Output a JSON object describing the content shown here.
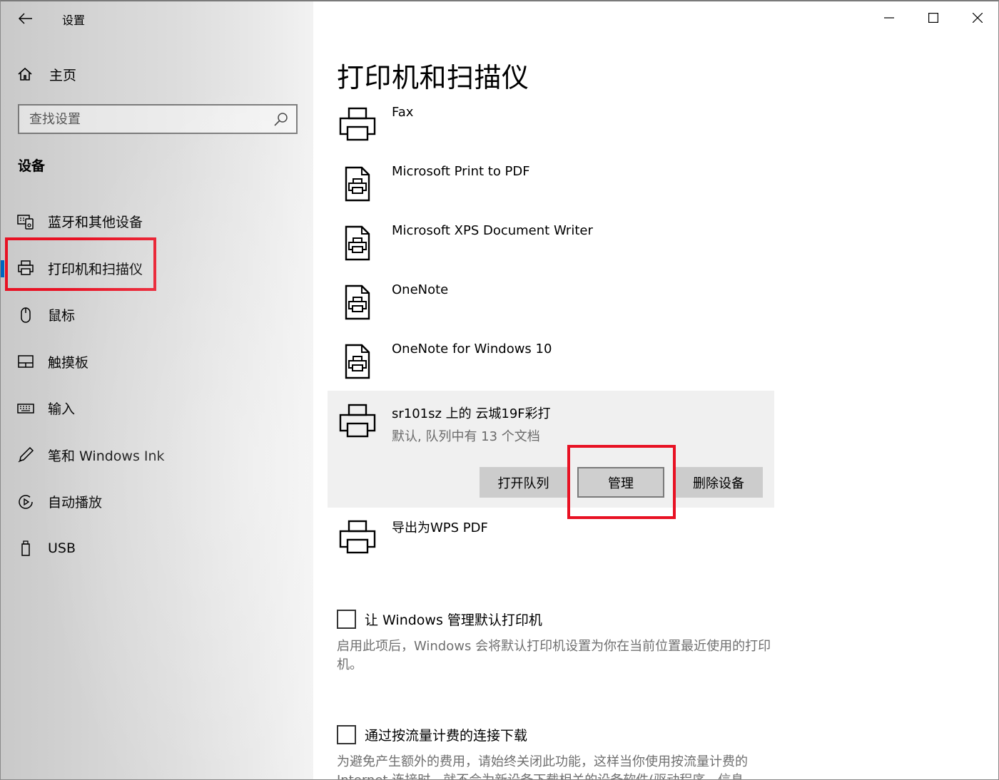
{
  "window": {
    "title": "设置"
  },
  "sidebar": {
    "home_label": "主页",
    "search_placeholder": "查找设置",
    "section_title": "设备",
    "items": [
      {
        "label": "蓝牙和其他设备",
        "icon": "bluetooth-devices-icon"
      },
      {
        "label": "打印机和扫描仪",
        "icon": "printer-icon",
        "active": true
      },
      {
        "label": "鼠标",
        "icon": "mouse-icon"
      },
      {
        "label": "触摸板",
        "icon": "touchpad-icon"
      },
      {
        "label": "输入",
        "icon": "keyboard-icon"
      },
      {
        "label": "笔和 Windows Ink",
        "icon": "pen-icon"
      },
      {
        "label": "自动播放",
        "icon": "autoplay-icon"
      },
      {
        "label": "USB",
        "icon": "usb-icon"
      }
    ]
  },
  "main": {
    "title": "打印机和扫描仪",
    "printers": [
      {
        "name": "Fax",
        "icon": "printer-icon"
      },
      {
        "name": "Microsoft Print to PDF",
        "icon": "document-printer-icon"
      },
      {
        "name": "Microsoft XPS Document Writer",
        "icon": "document-printer-icon"
      },
      {
        "name": "OneNote",
        "icon": "document-printer-icon"
      },
      {
        "name": "OneNote for Windows 10",
        "icon": "document-printer-icon"
      },
      {
        "name": "sr101sz 上的 云城19F彩打",
        "status": "默认, 队列中有 13 个文档",
        "icon": "printer-icon",
        "selected": true
      },
      {
        "name": "导出为WPS PDF",
        "icon": "printer-icon"
      }
    ],
    "actions": {
      "open_queue": "打开队列",
      "manage": "管理",
      "remove": "删除设备"
    },
    "options": [
      {
        "label": "让 Windows 管理默认打印机",
        "checked": false,
        "description": "启用此项后，Windows 会将默认打印机设置为你在当前位置最近使用的打印机。"
      },
      {
        "label": "通过按流量计费的连接下载",
        "checked": false,
        "description": "为避免产生额外的费用，请始终关闭此功能，这样当你使用按流量计费的 Internet 连接时，就不会为新设备下载相关的设备软件(驱动程序、信息"
      }
    ]
  },
  "colors": {
    "accent": "#0067c0",
    "highlight": "#e81123"
  }
}
